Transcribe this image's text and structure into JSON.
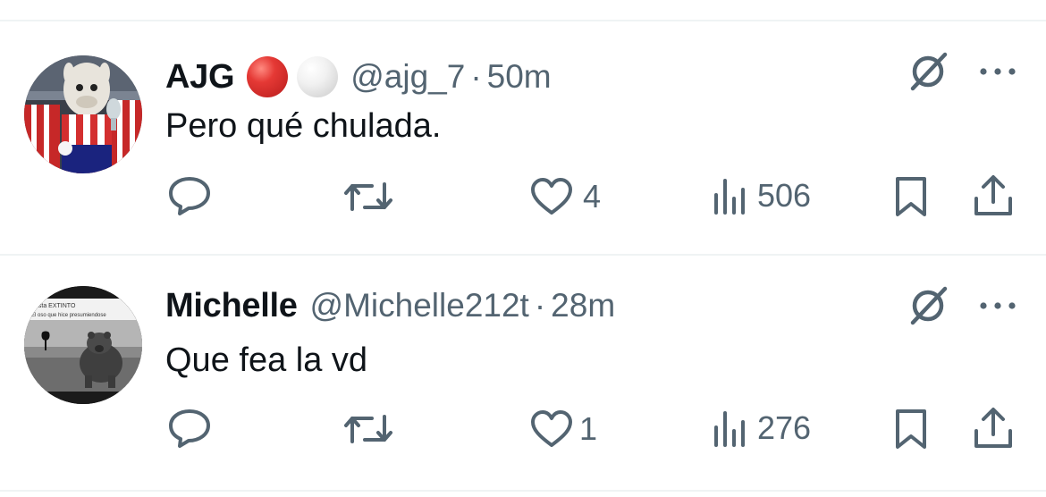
{
  "tweets": [
    {
      "display_name": "AJG",
      "name_emojis": [
        "red-circle",
        "white-circle"
      ],
      "handle": "@ajg_7",
      "separator": "·",
      "time": "50m",
      "text": "Pero qué chulada.",
      "actions": {
        "reply_count": "",
        "retweet_count": "",
        "like_count": "4",
        "view_count": "506"
      }
    },
    {
      "display_name": "Michelle",
      "name_emojis": [],
      "handle": "@Michelle212t",
      "separator": "·",
      "time": "28m",
      "text": "Que fea la vd",
      "avatar_caption_line1": "esta EXTINTO",
      "avatar_caption_line2": "El oso que hice presumiendose",
      "actions": {
        "reply_count": "",
        "retweet_count": "",
        "like_count": "1",
        "view_count": "276"
      }
    }
  ],
  "colors": {
    "text_primary": "#0f1419",
    "text_secondary": "#536471",
    "divider": "#eff3f4"
  },
  "icons": [
    "reply-icon",
    "retweet-icon",
    "like-icon",
    "views-icon",
    "bookmark-icon",
    "share-icon",
    "grok-icon",
    "more-icon"
  ]
}
